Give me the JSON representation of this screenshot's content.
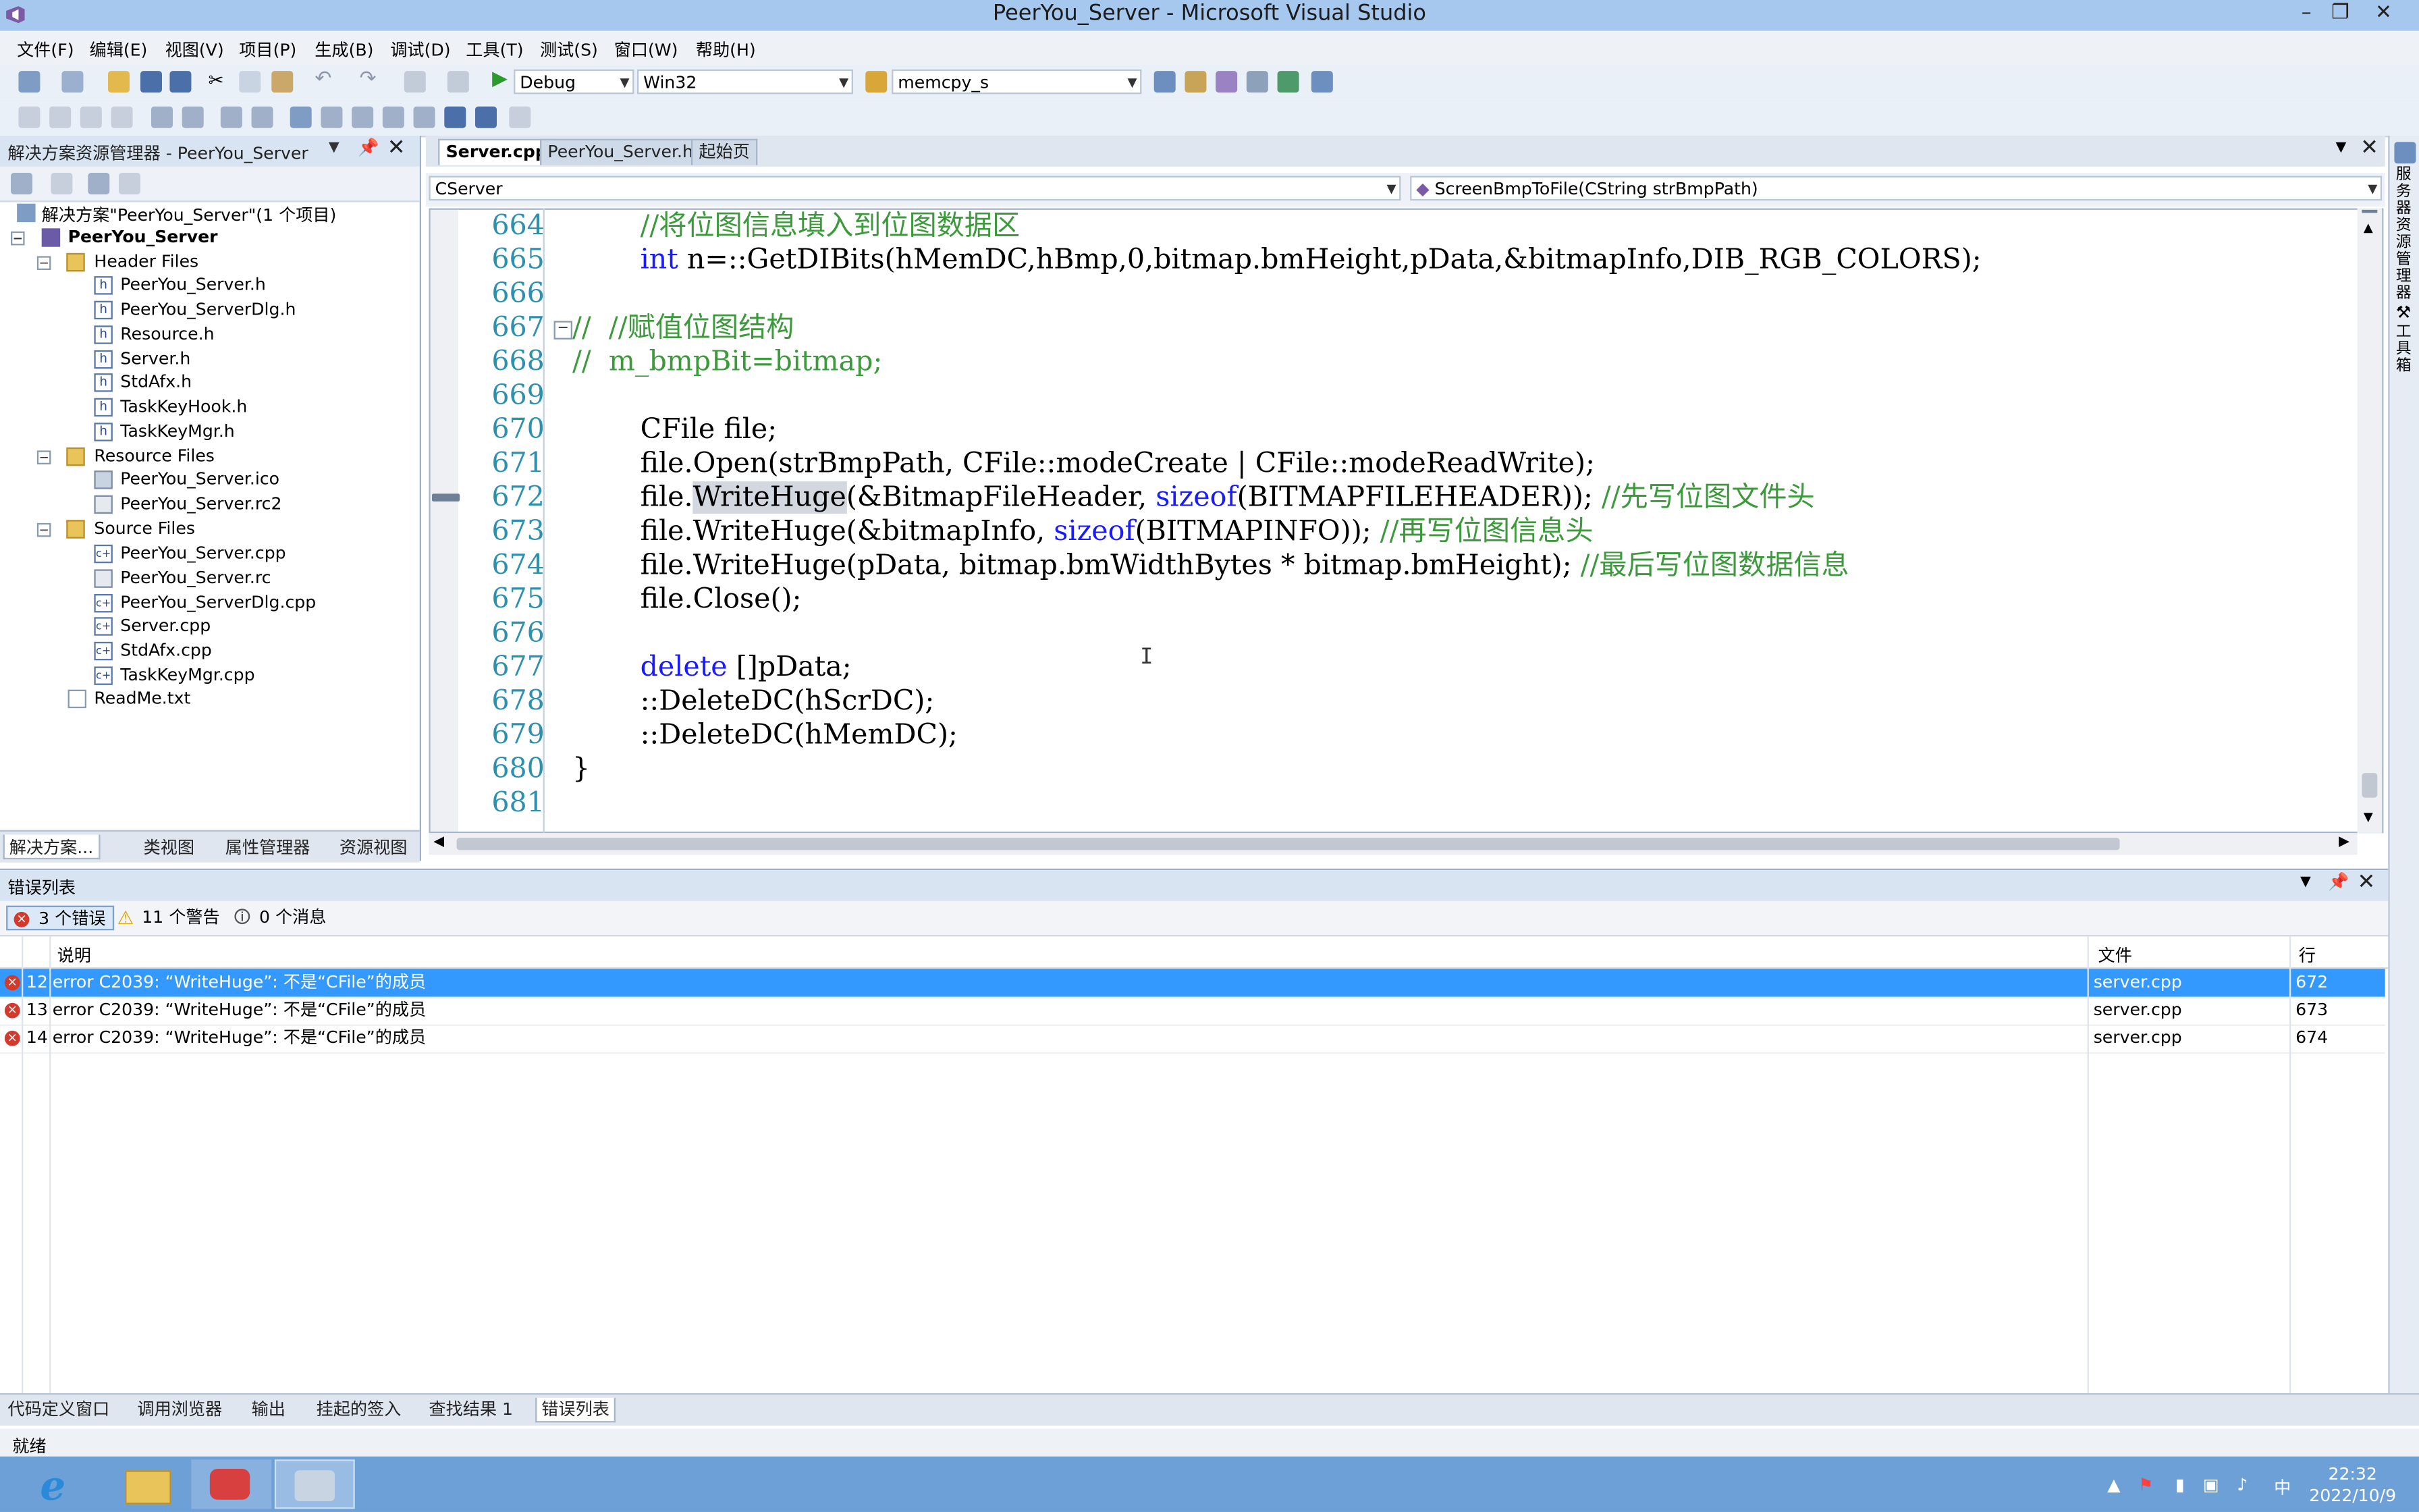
{
  "window": {
    "title": "PeerYou_Server - Microsoft Visual Studio",
    "controls": [
      "–",
      "❐",
      "✕"
    ]
  },
  "menu": [
    "文件(F)",
    "编辑(E)",
    "视图(V)",
    "项目(P)",
    "生成(B)",
    "调试(D)",
    "工具(T)",
    "测试(S)",
    "窗口(W)",
    "帮助(H)"
  ],
  "toolbar": {
    "config": "Debug",
    "platform": "Win32",
    "find": "memcpy_s"
  },
  "solution_explorer": {
    "title": "解决方案资源管理器 - PeerYou_Server",
    "solution": "解决方案\"PeerYou_Server\"(1 个项目)",
    "project": "PeerYou_Server",
    "folders": [
      {
        "name": "Header Files",
        "files": [
          "PeerYou_Server.h",
          "PeerYou_ServerDlg.h",
          "Resource.h",
          "Server.h",
          "StdAfx.h",
          "TaskKeyHook.h",
          "TaskKeyMgr.h"
        ]
      },
      {
        "name": "Resource Files",
        "files": [
          "PeerYou_Server.ico",
          "PeerYou_Server.rc2"
        ]
      },
      {
        "name": "Source Files",
        "files": [
          "PeerYou_Server.cpp",
          "PeerYou_Server.rc",
          "PeerYou_ServerDlg.cpp",
          "Server.cpp",
          "StdAfx.cpp",
          "TaskKeyMgr.cpp"
        ]
      }
    ],
    "readme": "ReadMe.txt",
    "tabs": [
      "解决方案...",
      "类视图",
      "属性管理器",
      "资源视图"
    ]
  },
  "editor": {
    "tabs": [
      "Server.cpp",
      "PeerYou_Server.h",
      "起始页"
    ],
    "class_combo": "CServer",
    "method_combo": "ScreenBmpToFile(CString strBmpPath)",
    "lines": [
      {
        "n": "664",
        "text": "    //将位图信息填入到位图数据区"
      },
      {
        "n": "665",
        "text": "    int n=::GetDIBits(hMemDC,hBmp,0,bitmap.bmHeight,pData,&bitmapInfo,DIB_RGB_COLORS);"
      },
      {
        "n": "666",
        "text": ""
      },
      {
        "n": "667",
        "text": "//  //赋值位图结构"
      },
      {
        "n": "668",
        "text": "//  m_bmpBit=bitmap;"
      },
      {
        "n": "669",
        "text": ""
      },
      {
        "n": "670",
        "text": "    CFile file;"
      },
      {
        "n": "671",
        "text": "    file.Open(strBmpPath, CFile::modeCreate | CFile::modeReadWrite);"
      },
      {
        "n": "672",
        "text": "    file.WriteHuge(&BitmapFileHeader, sizeof(BITMAPFILEHEADER)); //先写位图文件头"
      },
      {
        "n": "673",
        "text": "    file.WriteHuge(&bitmapInfo, sizeof(BITMAPINFO)); //再写位图信息头"
      },
      {
        "n": "674",
        "text": "    file.WriteHuge(pData, bitmap.bmWidthBytes * bitmap.bmHeight); //最后写位图数据信息"
      },
      {
        "n": "675",
        "text": "    file.Close();"
      },
      {
        "n": "676",
        "text": ""
      },
      {
        "n": "677",
        "text": "    delete []pData;"
      },
      {
        "n": "678",
        "text": "    ::DeleteDC(hScrDC);"
      },
      {
        "n": "679",
        "text": "    ::DeleteDC(hMemDC);"
      },
      {
        "n": "680",
        "text": "}"
      },
      {
        "n": "681",
        "text": ""
      }
    ]
  },
  "error_list": {
    "title": "错误列表",
    "filters": {
      "errors": "3 个错误",
      "warnings": "11 个警告",
      "messages": "0 个消息"
    },
    "columns": {
      "desc": "说明",
      "file": "文件",
      "line": "行"
    },
    "rows": [
      {
        "num": "12",
        "desc": "error C2039: “WriteHuge”: 不是“CFile”的成员",
        "file": "server.cpp",
        "line": "672"
      },
      {
        "num": "13",
        "desc": "error C2039: “WriteHuge”: 不是“CFile”的成员",
        "file": "server.cpp",
        "line": "673"
      },
      {
        "num": "14",
        "desc": "error C2039: “WriteHuge”: 不是“CFile”的成员",
        "file": "server.cpp",
        "line": "674"
      }
    ]
  },
  "bottom_tabs": [
    "代码定义窗口",
    "调用浏览器",
    "输出",
    "挂起的签入",
    "查找结果 1",
    "错误列表"
  ],
  "status": "就绪",
  "right_strip": [
    "服务器资源管理器",
    "工具箱"
  ],
  "taskbar": {
    "ime": "中",
    "time": "22:32",
    "date": "2022/10/9"
  }
}
